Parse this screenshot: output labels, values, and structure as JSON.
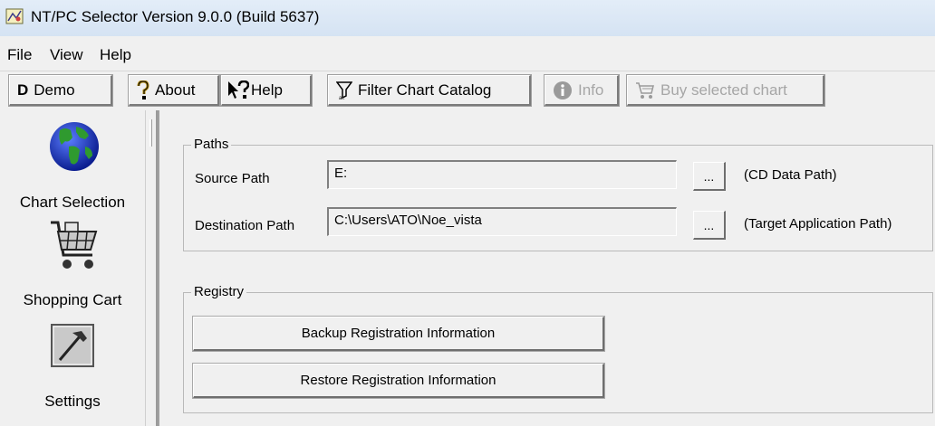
{
  "window": {
    "title": "NT/PC Selector Version 9.0.0 (Build 5637)"
  },
  "menu": {
    "items": [
      "File",
      "View",
      "Help"
    ]
  },
  "toolbar": {
    "demo": {
      "icon_glyph": "D",
      "label": "Demo"
    },
    "about": {
      "icon": "question-mark-icon",
      "label": "About"
    },
    "help": {
      "icon": "help-arrow-icon",
      "label": "Help"
    },
    "filter": {
      "icon": "filter-funnel-icon",
      "label": "Filter Chart Catalog"
    },
    "info": {
      "icon": "info-icon",
      "label": "Info",
      "disabled": true
    },
    "buy": {
      "icon": "shopping-cart-icon",
      "label": "Buy selected chart",
      "disabled": true
    }
  },
  "sidebar": {
    "items": [
      {
        "icon": "globe-icon",
        "label": "Chart Selection"
      },
      {
        "icon": "shopping-cart-icon",
        "label": "Shopping Cart"
      },
      {
        "icon": "hammer-tool-icon",
        "label": "Settings"
      }
    ]
  },
  "paths": {
    "legend": "Paths",
    "source": {
      "label": "Source Path",
      "value": "E:",
      "browse": "...",
      "hint": "(CD Data Path)"
    },
    "destination": {
      "label": "Destination Path",
      "value": "C:\\Users\\ATO\\Noe_vista",
      "browse": "...",
      "hint": "(Target Application Path)"
    }
  },
  "registry": {
    "legend": "Registry",
    "backup": "Backup Registration Information",
    "restore": "Restore Registration Information"
  },
  "colors": {
    "titlebar": "#dbe6f4",
    "window_bg": "#f0f0f0",
    "disabled_text": "#a6a6a6",
    "globe_blue": "#1f3fbf",
    "globe_green": "#2f9a2f"
  }
}
